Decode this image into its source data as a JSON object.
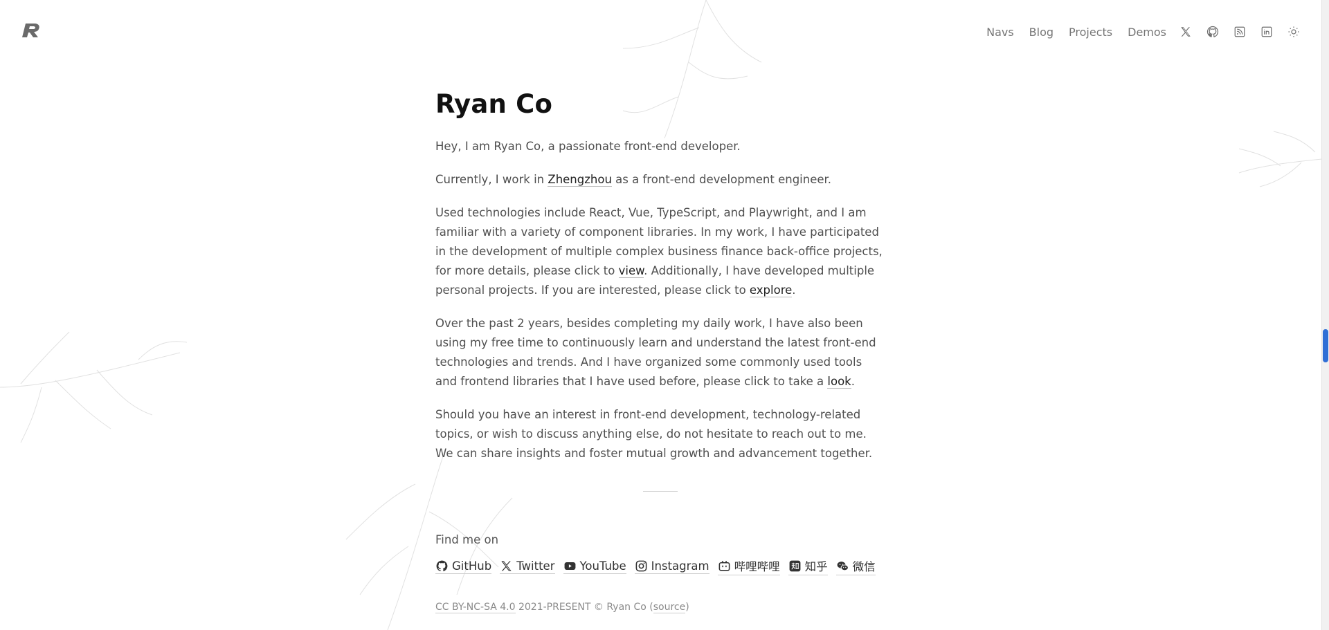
{
  "header": {
    "logo": "r-logo",
    "nav": [
      {
        "label": "Navs"
      },
      {
        "label": "Blog"
      },
      {
        "label": "Projects"
      },
      {
        "label": "Demos"
      }
    ],
    "icons": [
      "x-twitter-icon",
      "github-icon",
      "rss-icon",
      "linkedin-icon",
      "sun-theme-icon"
    ]
  },
  "main": {
    "title": "Ryan Co",
    "intro": "Hey, I am Ryan Co, a passionate front-end developer.",
    "p2": {
      "before": "Currently, I work in ",
      "link": "Zhengzhou",
      "after": " as a front-end development engineer."
    },
    "p3": {
      "t1": "Used technologies include React, Vue, TypeScript, and Playwright, and I am familiar with a variety of component libraries. In my work, I have participated in the development of multiple complex business finance back-office projects, for more details, please click to ",
      "link1": "view",
      "t2": ". Additionally, I have developed multiple personal projects. If you are interested, please click to ",
      "link2": "explore",
      "t3": "."
    },
    "p4": {
      "t1": "Over the past 2 years, besides completing my daily work, I have also been using my free time to continuously learn and understand the latest front-end technologies and trends. And I have organized some commonly used tools and frontend libraries that I have used before, please click to take a ",
      "link": "look",
      "t2": "."
    },
    "p5": "Should you have an interest in front-end development, technology-related topics, or wish to discuss anything else, do not hesitate to reach out to me. We can share insights and foster mutual growth and advancement together.",
    "find_me": "Find me on",
    "social": [
      {
        "label": "GitHub",
        "icon": "github-icon"
      },
      {
        "label": "Twitter",
        "icon": "x-icon"
      },
      {
        "label": "YouTube",
        "icon": "youtube-icon"
      },
      {
        "label": "Instagram",
        "icon": "instagram-icon"
      },
      {
        "label": "哔哩哔哩",
        "icon": "bilibili-icon"
      },
      {
        "label": "知乎",
        "icon": "zhihu-icon"
      },
      {
        "label": "微信",
        "icon": "wechat-icon"
      }
    ]
  },
  "footer": {
    "license": "CC BY-NC-SA 4.0",
    "copyright": "2021-PRESENT © Ryan Co",
    "source_open": "(",
    "source": "source",
    "source_close": ")"
  },
  "colors": {
    "scroll_thumb": "#2f6fd6"
  }
}
